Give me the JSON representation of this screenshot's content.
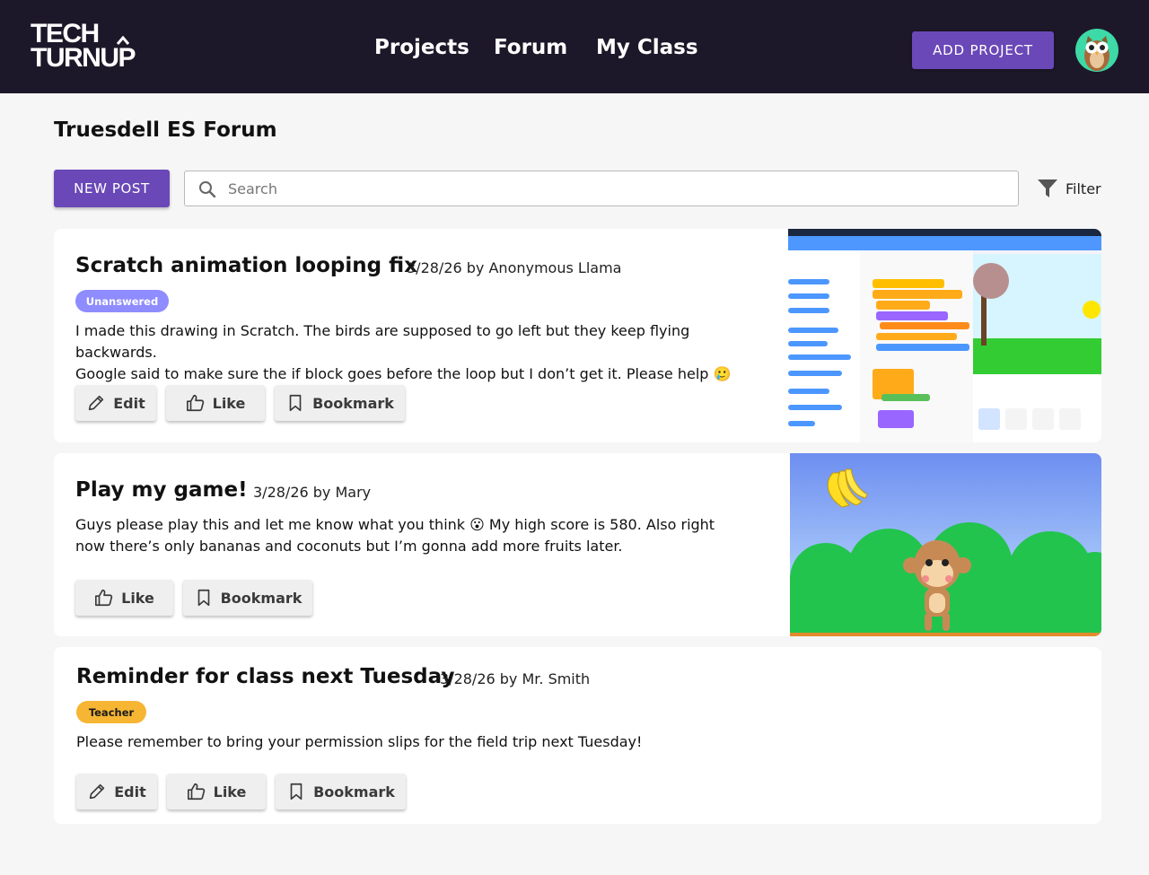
{
  "header": {
    "logo_line1": "TECH",
    "logo_line2": "TURNUP",
    "nav": [
      "Projects",
      "Forum",
      "My Class"
    ],
    "add_project_label": "ADD PROJECT",
    "avatar_icon": "owl-avatar-icon"
  },
  "page": {
    "title": "Truesdell ES Forum",
    "new_post_label": "NEW POST",
    "search_placeholder": "Search",
    "filter_label": "Filter"
  },
  "posts": [
    {
      "title": "Scratch animation looping fix",
      "meta": "3/28/26 by Anonymous Llama",
      "badge": "Unanswered",
      "body_line1": "I made this drawing in Scratch. The birds are supposed to go left but they keep flying backwards.",
      "body_line2": "Google said to make sure the if block goes before the loop but I don’t get it. Please help 🥲",
      "actions": [
        "Edit",
        "Like",
        "Bookmark"
      ],
      "image": "scratch-editor-screenshot"
    },
    {
      "title": "Play my game!",
      "meta": "3/28/26 by Mary",
      "body_line1": "Guys please play this and let me know what you think 😮 My high score is 580. Also right",
      "body_line2": "now there’s only bananas and coconuts but I’m gonna add more fruits later.",
      "actions": [
        "Like",
        "Bookmark"
      ],
      "image": "monkey-game-screenshot"
    },
    {
      "title": "Reminder for class next Tuesday",
      "meta": "3/28/26 by Mr. Smith",
      "badge": "Teacher",
      "body_line1": "Please remember to bring your permission slips for the field trip next Tuesday!",
      "actions": [
        "Edit",
        "Like",
        "Bookmark"
      ]
    }
  ],
  "colors": {
    "header_bg": "#1d1829",
    "primary": "#6a48b7",
    "unanswered_badge": "#8e8cff",
    "teacher_badge": "#f6b533",
    "avatar_bg": "#3dd9a6"
  }
}
